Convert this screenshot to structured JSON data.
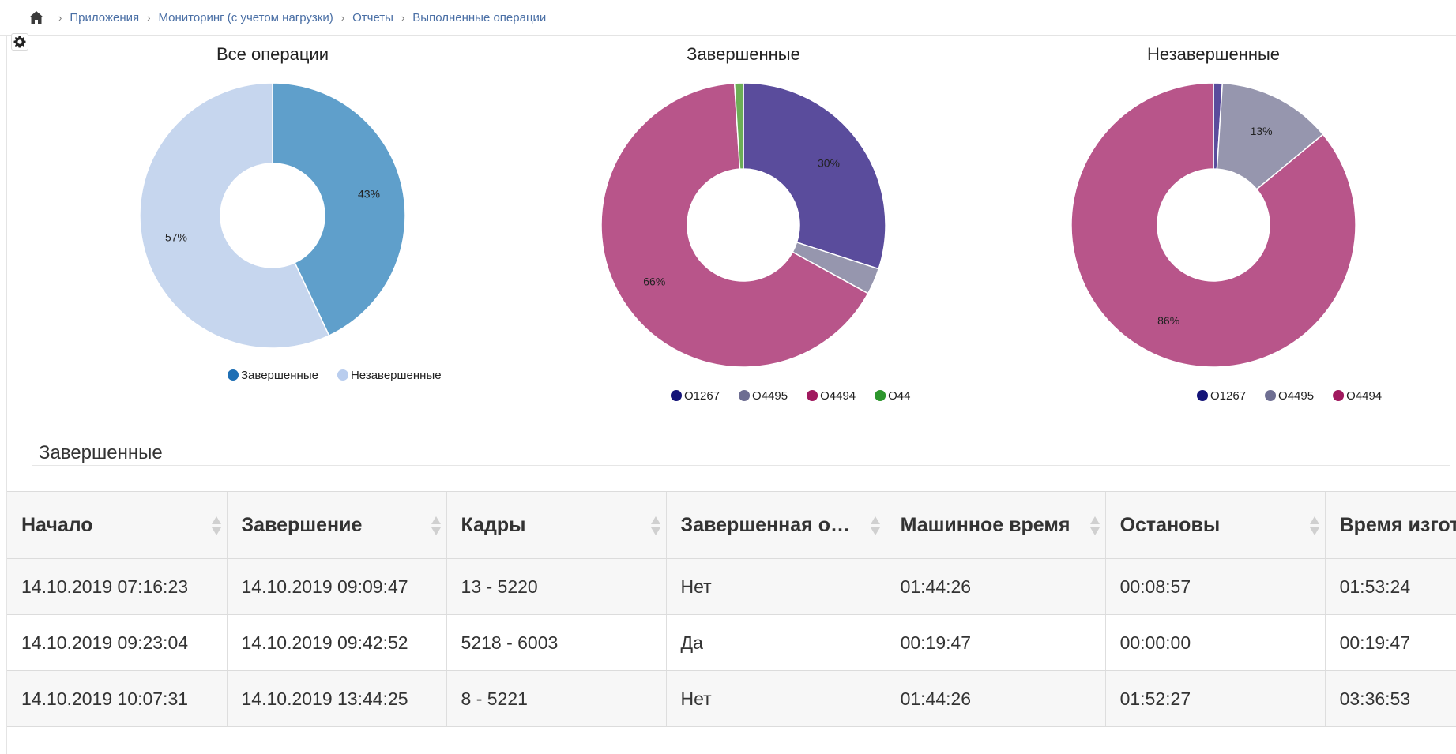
{
  "breadcrumb": {
    "items": [
      "Приложения",
      "Мониторинг (с учетом нагрузки)",
      "Отчеты",
      "Выполненные операции"
    ]
  },
  "chart_data": [
    {
      "type": "pie",
      "title": "Все операции",
      "labels": [
        "Завершенные",
        "Незавершенные"
      ],
      "values": [
        43,
        57
      ],
      "slice_labels": [
        "43%",
        "57%"
      ],
      "colors": [
        "#5f9fcb",
        "#c6d6ee"
      ],
      "legend_colors": [
        "#1f6fb4",
        "#b9cdee"
      ],
      "legend": "bottom"
    },
    {
      "type": "pie",
      "title": "Завершенные",
      "labels": [
        "O1267",
        "O4495",
        "O4494",
        "O44"
      ],
      "values": [
        30,
        3,
        66,
        1
      ],
      "slice_labels": [
        "30%",
        "",
        "66%",
        ""
      ],
      "colors": [
        "#5a4c9c",
        "#9696ae",
        "#b8558a",
        "#6cae56"
      ],
      "legend_colors": [
        "#141478",
        "#6e6e92",
        "#a0195e",
        "#2c962c"
      ],
      "legend": "bottom"
    },
    {
      "type": "pie",
      "title": "Незавершенные",
      "labels": [
        "O1267",
        "O4495",
        "O4494"
      ],
      "values": [
        1,
        13,
        86
      ],
      "slice_labels": [
        "",
        "13%",
        "86%"
      ],
      "colors": [
        "#5a4c9c",
        "#9696ae",
        "#b8558a"
      ],
      "legend_colors": [
        "#141478",
        "#6e6e92",
        "#a0195e"
      ],
      "legend": "bottom"
    }
  ],
  "completed_section": {
    "title": "Завершенные"
  },
  "table": {
    "columns": [
      "Начало",
      "Завершение",
      "Кадры",
      "Завершенная операция",
      "Машинное время",
      "Остановы",
      "Время изготовления"
    ],
    "rows": [
      [
        "14.10.2019 07:16:23",
        "14.10.2019 09:09:47",
        "13 - 5220",
        "Нет",
        "01:44:26",
        "00:08:57",
        "01:53:24"
      ],
      [
        "14.10.2019 09:23:04",
        "14.10.2019 09:42:52",
        "5218 - 6003",
        "Да",
        "00:19:47",
        "00:00:00",
        "00:19:47"
      ],
      [
        "14.10.2019 10:07:31",
        "14.10.2019 13:44:25",
        "8 - 5221",
        "Нет",
        "01:44:26",
        "01:52:27",
        "03:36:53"
      ]
    ]
  }
}
